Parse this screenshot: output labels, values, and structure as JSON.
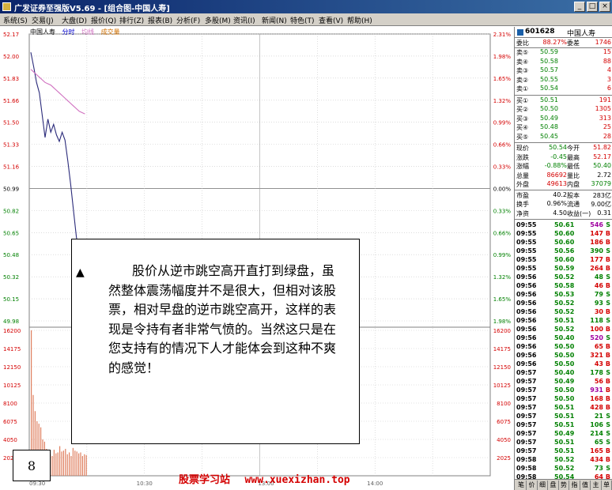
{
  "window": {
    "title": "广发证券至强版V5.69 - [组合图-中国人寿]",
    "controls": [
      "_",
      "□",
      "×"
    ]
  },
  "menu": [
    "系统(S)",
    "交易(J)",
    "大盘(D)",
    "报价(Q)",
    "排行(Z)",
    "报表(B)",
    "分析(F)",
    "多股(M)",
    "资讯(I)",
    "新闻(N)",
    "特色(T)",
    "查看(V)",
    "帮助(H)"
  ],
  "chart_header": {
    "name": "中国人寿",
    "tab_time": "分时",
    "tab_avg": "均线",
    "tab_vol": "成交量"
  },
  "chart_data": {
    "type": "line",
    "price_ticks_left": [
      "52.17",
      "52.00",
      "51.83",
      "51.66",
      "51.50",
      "51.33",
      "51.16",
      "50.99",
      "50.82",
      "50.65",
      "50.48",
      "50.32",
      "50.15",
      "49.98"
    ],
    "pct_ticks_right": [
      "2.31%",
      "1.98%",
      "1.65%",
      "1.32%",
      "0.99%",
      "0.66%",
      "0.33%",
      "0.00%",
      "0.33%",
      "0.66%",
      "0.99%",
      "1.32%",
      "1.65%",
      "1.98%"
    ],
    "volume_ticks": [
      "16200",
      "14175",
      "12150",
      "10125",
      "8100",
      "6075",
      "4050",
      "2025"
    ],
    "x_ticks": [
      "09:30",
      "10:30",
      "13:00",
      "14:00"
    ],
    "yrange": [
      49.98,
      52.17
    ],
    "series": [
      {
        "name": "分时",
        "values": [
          52.03,
          51.92,
          51.8,
          51.72,
          51.55,
          51.38,
          51.52,
          51.42,
          51.48,
          51.4,
          51.35,
          51.42,
          51.36,
          51.2,
          51.02,
          50.82,
          50.62,
          50.5,
          50.49,
          50.52
        ]
      },
      {
        "name": "均线",
        "values": [
          51.9,
          51.88,
          51.86,
          51.84,
          51.82,
          51.8,
          51.79,
          51.78,
          51.76,
          51.74,
          51.72,
          51.7,
          51.68,
          51.66,
          51.64,
          51.62,
          51.6,
          51.58,
          51.57,
          51.56
        ]
      }
    ],
    "volume": [
      16200,
      9000,
      7200,
      6075,
      5800,
      5400,
      4050,
      3800,
      3000,
      2600,
      2400,
      2200,
      2900,
      2500,
      2600,
      3300,
      2700,
      2800,
      3000,
      2400,
      2600,
      2200,
      3100,
      2800,
      2700,
      2500,
      2600,
      2200,
      2400,
      2300
    ]
  },
  "note": {
    "text": "股价从逆市跳空高开直打到绿盘，虽然整体震荡幅度并不是很大，但相对该股票，相对早盘的逆市跳空高开，这样的表现是令持有者非常气愤的。当然这只是在您支持有的情况下人才能体会到这种不爽的感觉！",
    "arrow": "▲",
    "page": "8"
  },
  "watermark": {
    "name": "股票学习站",
    "site": "www.xuexizhan.top"
  },
  "panel": {
    "code": "601628",
    "name": "中国人寿",
    "wb": {
      "label": "委比",
      "value": "88.27%",
      "label2": "委差",
      "value2": "1746"
    },
    "asks": [
      {
        "label": "卖⑤",
        "price": "50.59",
        "vol": "15"
      },
      {
        "label": "卖④",
        "price": "50.58",
        "vol": "88"
      },
      {
        "label": "卖③",
        "price": "50.57",
        "vol": "4"
      },
      {
        "label": "卖②",
        "price": "50.55",
        "vol": "3"
      },
      {
        "label": "卖①",
        "price": "50.54",
        "vol": "6"
      }
    ],
    "bids": [
      {
        "label": "买①",
        "price": "50.51",
        "vol": "191"
      },
      {
        "label": "买②",
        "price": "50.50",
        "vol": "1305"
      },
      {
        "label": "买③",
        "price": "50.49",
        "vol": "313"
      },
      {
        "label": "买④",
        "price": "50.48",
        "vol": "25"
      },
      {
        "label": "买⑤",
        "price": "50.45",
        "vol": "28"
      }
    ],
    "quote": [
      {
        "l": "现价",
        "v": "50.54",
        "vc": "green",
        "l2": "今开",
        "v2": "51.82",
        "v2c": "red"
      },
      {
        "l": "涨跌",
        "v": "-0.45",
        "vc": "green",
        "l2": "最高",
        "v2": "52.17",
        "v2c": "red"
      },
      {
        "l": "涨幅",
        "v": "-0.88%",
        "vc": "green",
        "l2": "最低",
        "v2": "50.40",
        "v2c": "green"
      },
      {
        "l": "总量",
        "v": "86692",
        "vc": "red",
        "l2": "量比",
        "v2": "2.72",
        "v2c": ""
      },
      {
        "l": "外盘",
        "v": "49613",
        "vc": "red",
        "l2": "内盘",
        "v2": "37079",
        "v2c": "green"
      },
      {
        "l": "市盈",
        "v": "40.2",
        "vc": "",
        "l2": "股本",
        "v2": "283亿",
        "v2c": ""
      },
      {
        "l": "换手",
        "v": "0.96%",
        "vc": "",
        "l2": "流通",
        "v2": "9.00亿",
        "v2c": ""
      },
      {
        "l": "净资",
        "v": "4.50",
        "vc": "",
        "l2": "收益(一)",
        "v2": "0.31",
        "v2c": ""
      }
    ],
    "ticks": [
      {
        "t": "09:55",
        "p": "50.61",
        "v": "546",
        "vc": "purple",
        "bs": "S"
      },
      {
        "t": "09:55",
        "p": "50.60",
        "v": "147",
        "vc": "red",
        "bs": "B"
      },
      {
        "t": "09:55",
        "p": "50.60",
        "v": "186",
        "vc": "red",
        "bs": "B"
      },
      {
        "t": "09:55",
        "p": "50.56",
        "v": "390",
        "vc": "green",
        "bs": "S"
      },
      {
        "t": "09:55",
        "p": "50.60",
        "v": "177",
        "vc": "red",
        "bs": "B"
      },
      {
        "t": "09:55",
        "p": "50.59",
        "v": "264",
        "vc": "red",
        "bs": "B"
      },
      {
        "t": "09:56",
        "p": "50.52",
        "v": "48",
        "vc": "green",
        "bs": "S"
      },
      {
        "t": "09:56",
        "p": "50.58",
        "v": "46",
        "vc": "red",
        "bs": "B"
      },
      {
        "t": "09:56",
        "p": "50.53",
        "v": "79",
        "vc": "green",
        "bs": "S"
      },
      {
        "t": "09:56",
        "p": "50.52",
        "v": "93",
        "vc": "green",
        "bs": "S"
      },
      {
        "t": "09:56",
        "p": "50.52",
        "v": "30",
        "vc": "red",
        "bs": "B"
      },
      {
        "t": "09:56",
        "p": "50.51",
        "v": "118",
        "vc": "green",
        "bs": "S"
      },
      {
        "t": "09:56",
        "p": "50.52",
        "v": "100",
        "vc": "red",
        "bs": "B"
      },
      {
        "t": "09:56",
        "p": "50.40",
        "v": "520",
        "vc": "purple",
        "bs": "S"
      },
      {
        "t": "09:56",
        "p": "50.50",
        "v": "65",
        "vc": "red",
        "bs": "B"
      },
      {
        "t": "09:56",
        "p": "50.50",
        "v": "321",
        "vc": "red",
        "bs": "B"
      },
      {
        "t": "09:56",
        "p": "50.50",
        "v": "43",
        "vc": "red",
        "bs": "B"
      },
      {
        "t": "09:57",
        "p": "50.40",
        "v": "178",
        "vc": "green",
        "bs": "S"
      },
      {
        "t": "09:57",
        "p": "50.49",
        "v": "56",
        "vc": "red",
        "bs": "B"
      },
      {
        "t": "09:57",
        "p": "50.50",
        "v": "931",
        "vc": "purple",
        "bs": "B"
      },
      {
        "t": "09:57",
        "p": "50.50",
        "v": "168",
        "vc": "red",
        "bs": "B"
      },
      {
        "t": "09:57",
        "p": "50.51",
        "v": "428",
        "vc": "red",
        "bs": "B"
      },
      {
        "t": "09:57",
        "p": "50.51",
        "v": "21",
        "vc": "green",
        "bs": "S"
      },
      {
        "t": "09:57",
        "p": "50.51",
        "v": "106",
        "vc": "green",
        "bs": "S"
      },
      {
        "t": "09:57",
        "p": "50.49",
        "v": "214",
        "vc": "green",
        "bs": "S"
      },
      {
        "t": "09:57",
        "p": "50.51",
        "v": "65",
        "vc": "green",
        "bs": "S"
      },
      {
        "t": "09:57",
        "p": "50.51",
        "v": "165",
        "vc": "red",
        "bs": "B"
      },
      {
        "t": "09:58",
        "p": "50.52",
        "v": "434",
        "vc": "red",
        "bs": "B"
      },
      {
        "t": "09:58",
        "p": "50.52",
        "v": "73",
        "vc": "green",
        "bs": "S"
      },
      {
        "t": "09:58",
        "p": "50.54",
        "v": "64",
        "vc": "red",
        "bs": "B"
      }
    ],
    "tabs": [
      "笔",
      "价",
      "细",
      "盘",
      "势",
      "指",
      "值",
      "主",
      "单"
    ]
  },
  "colors": {
    "price_line": "#2a2a7a",
    "avg_line": "#d070c0",
    "grid": "#c8c8c8",
    "axis_red": "#d40000",
    "axis_green": "#008000",
    "volume_bar": "#e08060"
  }
}
